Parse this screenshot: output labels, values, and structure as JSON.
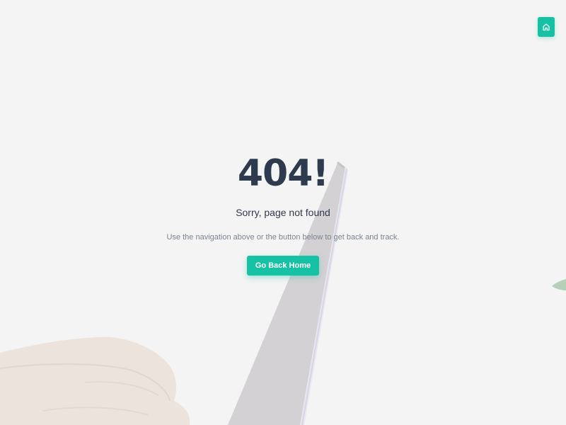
{
  "header": {
    "home_icon": "home-icon"
  },
  "error": {
    "code": "404!",
    "title": "Sorry, page not found",
    "description": "Use the navigation above or the button below to get back and track."
  },
  "actions": {
    "go_home_label": "Go Back Home"
  },
  "colors": {
    "accent": "#16c2a3",
    "heading": "#2e3a4e",
    "muted": "#7b8494"
  }
}
